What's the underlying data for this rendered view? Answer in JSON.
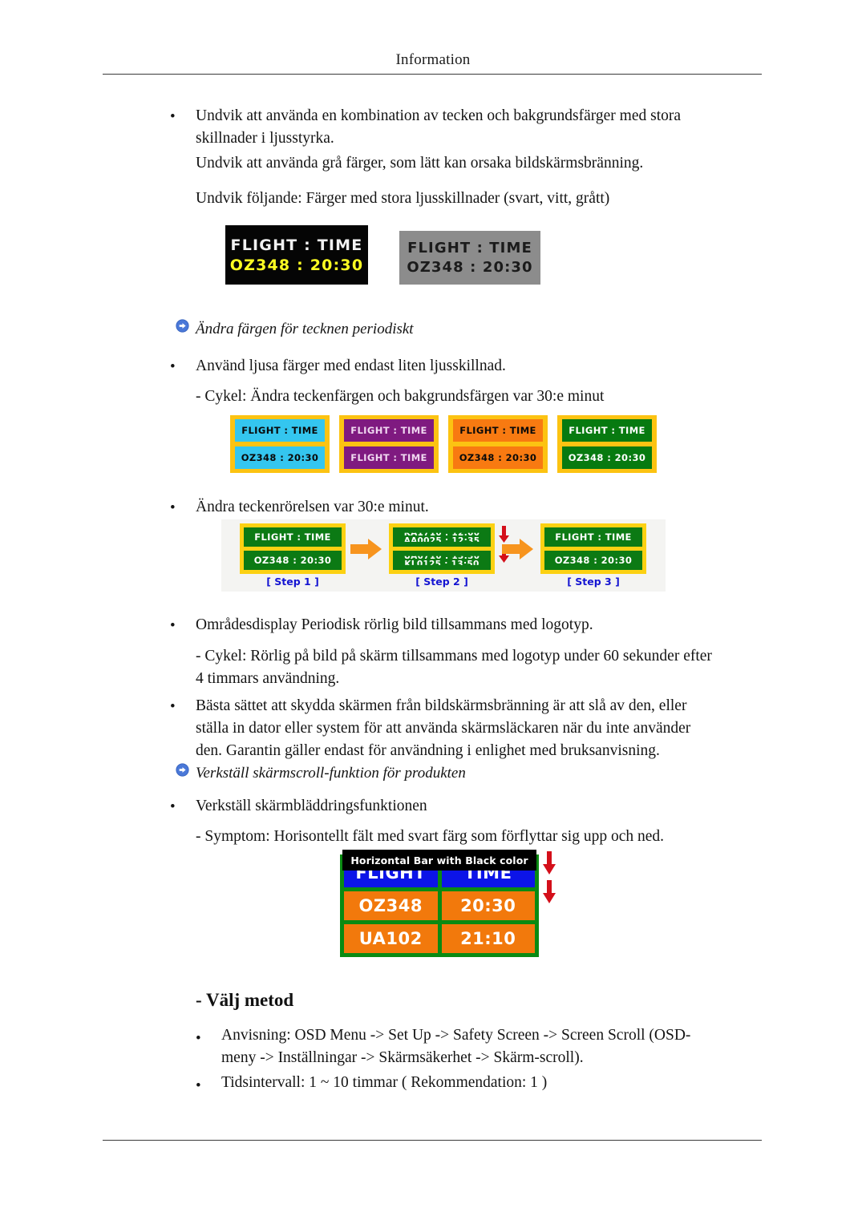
{
  "header": {
    "title": "Information"
  },
  "body": {
    "para1": "Undvik att använda en kombination av tecken och bakgrundsfärger med stora skillnader i ljusstyrka.",
    "para2": "Undvik att använda grå färger, som lätt kan orsaka bildskärmsbränning.",
    "para3": "Undvik följande: Färger med stora ljusskillnader (svart, vitt, grått)",
    "heading1": "Ändra färgen för tecknen periodiskt",
    "para4": "Använd ljusa färger med endast liten ljusskillnad.",
    "para5": "- Cykel: Ändra teckenfärgen och bakgrundsfärgen var 30:e minut",
    "para6": "Ändra teckenrörelsen var 30:e minut.",
    "para7": "Områdesdisplay Periodisk rörlig bild tillsammans med logotyp.",
    "para8": "- Cykel: Rörlig på bild på skärm tillsammans med logotyp under 60 sekunder efter 4 timmars användning.",
    "para9": "Bästa sättet att skydda skärmen från bildskärmsbränning är att slå av den, eller ställa in dator eller system för att använda skärmsläckaren när du inte använder den. Garantin gäller endast för användning i enlighet med bruksanvisning.",
    "heading2": "Verkställ skärmscroll-funktion för produkten",
    "para10": "Verkställ skärmbläddringsfunktionen",
    "para11": "- Symptom: Horisontellt fält med svart färg som förflyttar sig upp och ned.",
    "section_title": "- Välj metod",
    "para12": "Anvisning: OSD Menu -> Set Up -> Safety Screen -> Screen Scroll (OSD-meny -> Inställningar -> Skärmsäkerhet -> Skärm-scroll).",
    "para13": "Tidsintervall: 1 ~ 10 timmar ( Rekommendation: 1 )",
    "bullet_glyph": "•"
  },
  "figure_contrast": {
    "black_panel": {
      "line1": "FLIGHT : TIME",
      "line2": "OZ348  : 20:30",
      "bg": "#050505",
      "line1_color": "#f2f2f2",
      "line2_color": "#ffff22"
    },
    "grey_panel": {
      "line1": "FLIGHT : TIME",
      "line2": "OZ348  : 20:30",
      "bg": "#8c8c8c",
      "text_color": "#1b1b1b"
    }
  },
  "figure_colors": {
    "border_color": "#fcc312",
    "panels": [
      {
        "name": "cyan",
        "bg": "#34c6ef",
        "fg": "#0a0a0a",
        "line1": "FLIGHT : TIME",
        "line2": "OZ348   : 20:30"
      },
      {
        "name": "purple",
        "bg": "#7f1a80",
        "fg": "#f0d8f0",
        "line1": "FLIGHT : TIME",
        "line2": "FLIGHT : TIME"
      },
      {
        "name": "orange",
        "bg": "#f87a11",
        "fg": "#0a0a0a",
        "line1": "FLIGHT : TIME",
        "line2": "OZ348   : 20:30"
      },
      {
        "name": "green",
        "bg": "#077a10",
        "fg": "#ffffff",
        "line1": "FLIGHT : TIME",
        "line2": "OZ348   : 20:30"
      }
    ]
  },
  "figure_steps": {
    "arrow_color": "#f7941e",
    "down_arrow_color": "#d40f1a",
    "label_color": "#1414d2",
    "steps": [
      {
        "label": "[ Step 1 ]",
        "line1": "FLIGHT : TIME",
        "line2": "OZ348  : 20:30"
      },
      {
        "label": "[ Step 2 ]",
        "cell1_top": "KA1710 : 12:00",
        "cell1_bottom": "AA0025 : 12:35",
        "cell2_top": "UA0710 : 13:30",
        "cell2_bottom": "KL0125 : 13:50"
      },
      {
        "label": "[ Step 3 ]",
        "line1": "FLIGHT : TIME",
        "line2": "OZ348  : 20:30"
      }
    ]
  },
  "figure_scroll": {
    "bar_caption": "Horizontal Bar with Black color",
    "bar_bg": "#000000",
    "bar_fg": "#ffffff",
    "screen_bg": "#0a8a12",
    "head_bg": "#0c14e8",
    "data_bg": "#f2790c",
    "rows": [
      {
        "type": "head",
        "left": "FLIGHT",
        "right": "TIME"
      },
      {
        "type": "data",
        "left": "OZ348",
        "right": "20:30"
      },
      {
        "type": "data",
        "left": "UA102",
        "right": "21:10"
      }
    ]
  }
}
